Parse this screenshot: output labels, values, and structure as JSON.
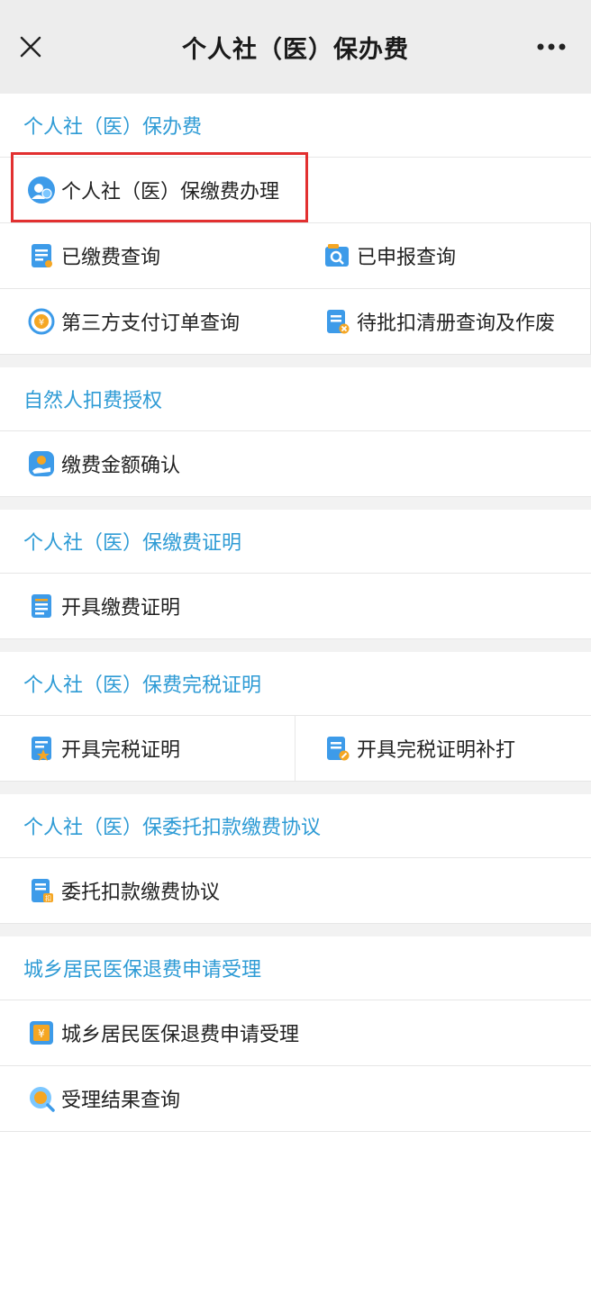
{
  "topbar": {
    "title": "个人社（医）保办费",
    "close_icon": "close-icon",
    "more_icon": "more-icon"
  },
  "sections": [
    {
      "header": "个人社（医）保办费",
      "items": [
        {
          "label": "个人社（医）保缴费办理",
          "icon": "person-coin-icon",
          "full": true,
          "highlight": true
        },
        {
          "label": "已缴费查询",
          "icon": "document-icon"
        },
        {
          "label": "已申报查询",
          "icon": "search-folder-icon"
        },
        {
          "label": "第三方支付订单查询",
          "icon": "yuan-refresh-icon"
        },
        {
          "label": "待批扣清册查询及作废",
          "icon": "document-cancel-icon"
        }
      ]
    },
    {
      "header": "自然人扣费授权",
      "items": [
        {
          "label": "缴费金额确认",
          "icon": "hand-coin-icon",
          "full": true
        }
      ]
    },
    {
      "header": "个人社（医）保缴费证明",
      "items": [
        {
          "label": "开具缴费证明",
          "icon": "list-document-icon",
          "full": true
        }
      ]
    },
    {
      "header": "个人社（医）保费完税证明",
      "items": [
        {
          "label": "开具完税证明",
          "icon": "certificate-star-icon"
        },
        {
          "label": "开具完税证明补打",
          "icon": "document-pen-icon"
        }
      ]
    },
    {
      "header": "个人社（医）保委托扣款缴费协议",
      "items": [
        {
          "label": "委托扣款缴费协议",
          "icon": "agreement-icon",
          "full": true
        }
      ]
    },
    {
      "header": "城乡居民医保退费申请受理",
      "items": [
        {
          "label": "城乡居民医保退费申请受理",
          "icon": "refund-icon",
          "full": true
        },
        {
          "label": "受理结果查询",
          "icon": "magnifier-result-icon",
          "full": true
        }
      ]
    }
  ],
  "colors": {
    "accent": "#2e9bd5",
    "highlight_border": "#e23030",
    "icon_blue": "#3d9be9",
    "icon_orange": "#f5a623"
  }
}
